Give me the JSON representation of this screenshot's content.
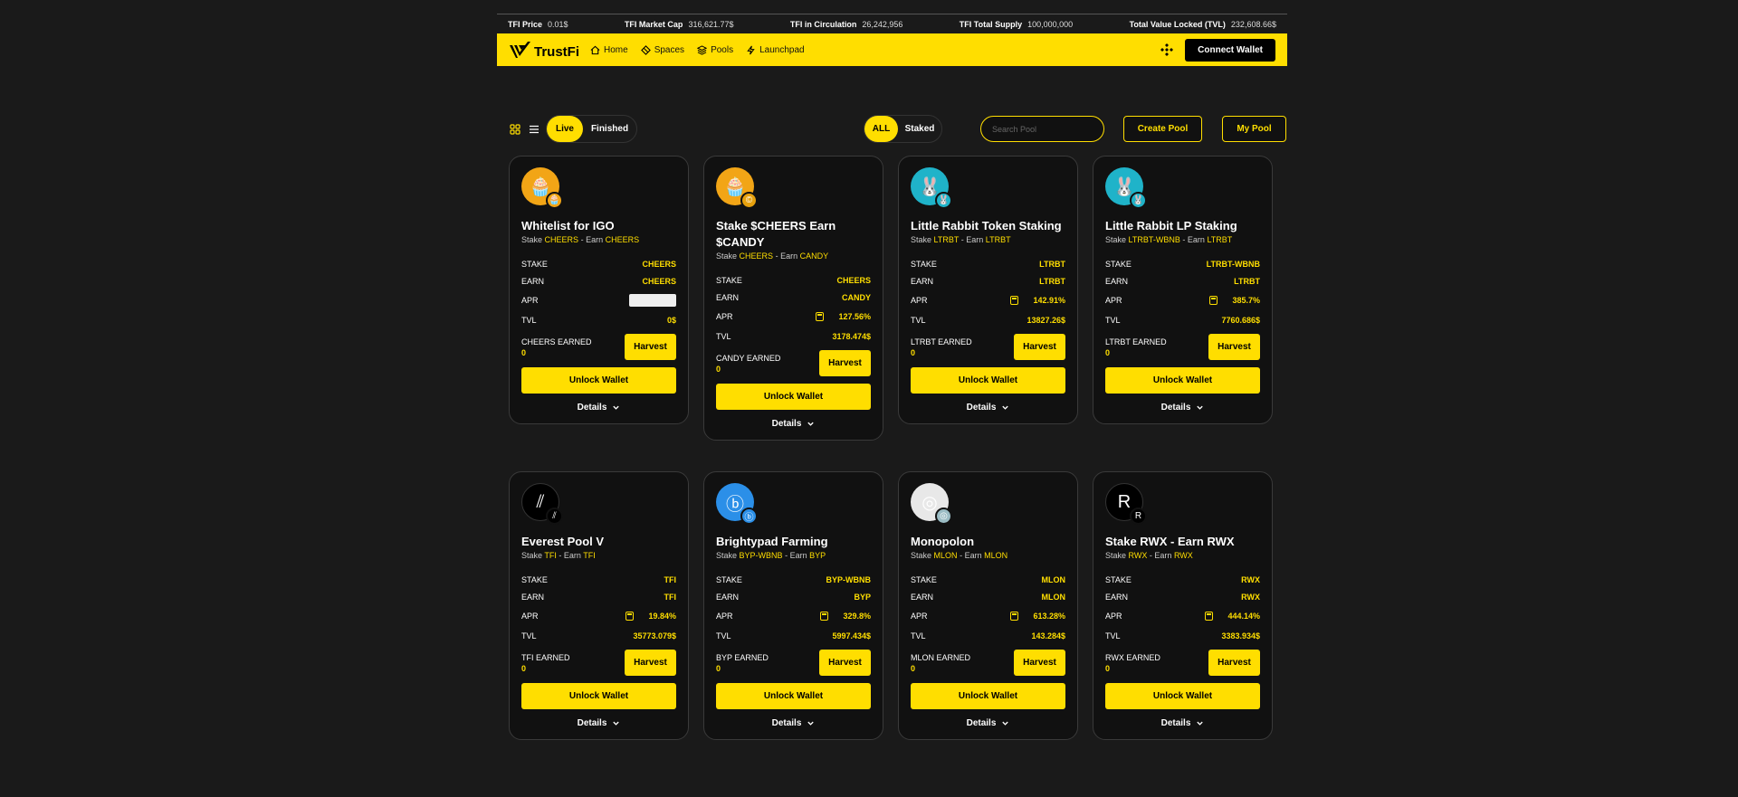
{
  "ticker": [
    {
      "label": "TFI Price",
      "value": "0.01$"
    },
    {
      "label": "TFI Market Cap",
      "value": "316,621.77$"
    },
    {
      "label": "TFI in Circulation",
      "value": "26,242,956"
    },
    {
      "label": "TFI Total Supply",
      "value": "100,000,000"
    },
    {
      "label": "Total Value Locked (TVL)",
      "value": "232,608.66$"
    }
  ],
  "nav": {
    "brand": "TrustFi",
    "links": [
      "Home",
      "Spaces",
      "Pools",
      "Launchpad"
    ],
    "connect_label": "Connect Wallet"
  },
  "toolbar": {
    "status_tabs": [
      "Live",
      "Finished"
    ],
    "filter_tabs": [
      "ALL",
      "Staked"
    ],
    "search_placeholder": "Search Pool",
    "create_pool": "Create Pool",
    "my_pool": "My Pool"
  },
  "labels": {
    "stake": "STAKE",
    "earn": "EARN",
    "apr": "APR",
    "tvl": "TVL",
    "harvest": "Harvest",
    "unlock": "Unlock Wallet",
    "details": "Details",
    "stake_word": "Stake",
    "earn_word": "Earn",
    "dash": "-"
  },
  "pools": [
    {
      "title": "Whitelist for IGO",
      "stake_token": "CHEERS",
      "earn_token": "CHEERS",
      "apr": "",
      "tvl": "0$",
      "earned_label": "CHEERS EARNED",
      "earned": "0",
      "icon": "cheers-icon",
      "badge": "cheers-icon",
      "color": "#f2a516",
      "badge_color": "#f2a516"
    },
    {
      "title": "Stake $CHEERS Earn $CANDY",
      "stake_token": "CHEERS",
      "earn_token": "CANDY",
      "apr": "127.56%",
      "tvl": "3178.474$",
      "earned_label": "CANDY EARNED",
      "earned": "0",
      "icon": "cheers-icon",
      "badge": "candy-icon",
      "color": "#f2a516",
      "badge_color": "#e7a10e"
    },
    {
      "title": "Little Rabbit Token Staking",
      "stake_token": "LTRBT",
      "earn_token": "LTRBT",
      "apr": "142.91%",
      "tvl": "13827.26$",
      "earned_label": "LTRBT EARNED",
      "earned": "0",
      "icon": "rabbit-icon",
      "badge": "rabbit-icon",
      "color": "#1fb3c9",
      "badge_color": "#1fb3c9"
    },
    {
      "title": "Little Rabbit LP Staking",
      "stake_token": "LTRBT-WBNB",
      "earn_token": "LTRBT",
      "apr": "385.7%",
      "tvl": "7760.686$",
      "earned_label": "LTRBT EARNED",
      "earned": "0",
      "icon": "rabbit-icon",
      "badge": "rabbit-icon",
      "color": "#1fb3c9",
      "badge_color": "#1fb3c9"
    },
    {
      "title": "Everest Pool V",
      "stake_token": "TFI",
      "earn_token": "TFI",
      "apr": "19.84%",
      "tvl": "35773.079$",
      "earned_label": "TFI EARNED",
      "earned": "0",
      "icon": "trustfi-icon",
      "badge": "trustfi-icon",
      "color": "#000000",
      "badge_color": "#000000"
    },
    {
      "title": "Brightypad Farming",
      "stake_token": "BYP-WBNB",
      "earn_token": "BYP",
      "apr": "329.8%",
      "tvl": "5997.434$",
      "earned_label": "BYP EARNED",
      "earned": "0",
      "icon": "brightypad-icon",
      "badge": "brightypad-icon",
      "color": "#2b8fe8",
      "badge_color": "#2b8fe8"
    },
    {
      "title": "Monopolon",
      "stake_token": "MLON",
      "earn_token": "MLON",
      "apr": "613.28%",
      "tvl": "143.284$",
      "earned_label": "MLON EARNED",
      "earned": "0",
      "icon": "monopolon-icon",
      "badge": "monopolon-icon",
      "color": "#e8e8e8",
      "badge_color": "#9bbcc4"
    },
    {
      "title": "Stake RWX - Earn RWX",
      "stake_token": "RWX",
      "earn_token": "RWX",
      "apr": "444.14%",
      "tvl": "3383.934$",
      "earned_label": "RWX EARNED",
      "earned": "0",
      "icon": "rwx-icon",
      "badge": "rwx-icon",
      "color": "#000000",
      "badge_color": "#000000"
    }
  ],
  "colors": {
    "accent": "#ffde00",
    "background": "#1a1a1a",
    "card": "#111111"
  }
}
